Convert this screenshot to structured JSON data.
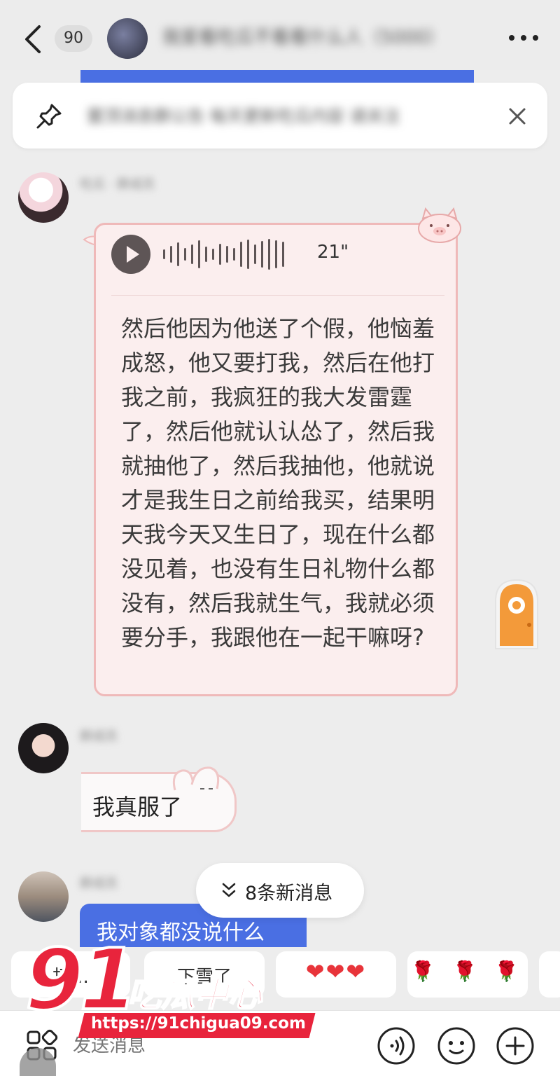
{
  "header": {
    "unread_count": "90",
    "group_title": "我爱看吃瓜不看看什么人（5000）"
  },
  "pinned": {
    "text": "置顶消息群公告 每天更新吃瓜内容 请关注"
  },
  "messages": [
    {
      "sender": "吃瓜 · 群成员",
      "voice": {
        "duration": "21\"",
        "transcript": "然后他因为他送了个假，他恼羞成怒，他又要打我，然后在他打我之前，我疯狂的我大发雷霆了，然后他就认认怂了，然后我就抽他了，然后我抽他，他就说才是我生日之前给我买，结果明天我今天又生日了，现在什么都没见着，也没有生日礼物什么都没有，然后我就生气，我就必须要分手，我跟他在一起干嘛呀?"
      }
    },
    {
      "sender": "群成员",
      "text": "我真服了"
    },
    {
      "sender": "群成员",
      "text": "我对象都没说什么"
    }
  ],
  "new_messages": "8条新消息",
  "quick_replies": [
    "打…",
    "下雪了",
    "❤❤❤",
    "🌹 🌹 🌹"
  ],
  "input": {
    "placeholder": "发送消息"
  },
  "watermark": {
    "number": "91",
    "name": "吃瓜中心",
    "url": "https://91chigua09.com"
  },
  "colors": {
    "accent_blue": "#4a6fe3",
    "voice_bubble_bg": "#fbeeee",
    "voice_bubble_border": "#efb9b9",
    "watermark_red": "#e8243c"
  },
  "icons": {
    "back": "back-arrow-icon",
    "more": "more-icon",
    "pin": "pin-icon",
    "close": "close-icon",
    "play": "play-icon",
    "new_messages": "double-chevron-down-icon",
    "apps": "apps-icon",
    "voice": "voice-input-icon",
    "emoji": "emoji-icon",
    "plus": "plus-icon"
  }
}
